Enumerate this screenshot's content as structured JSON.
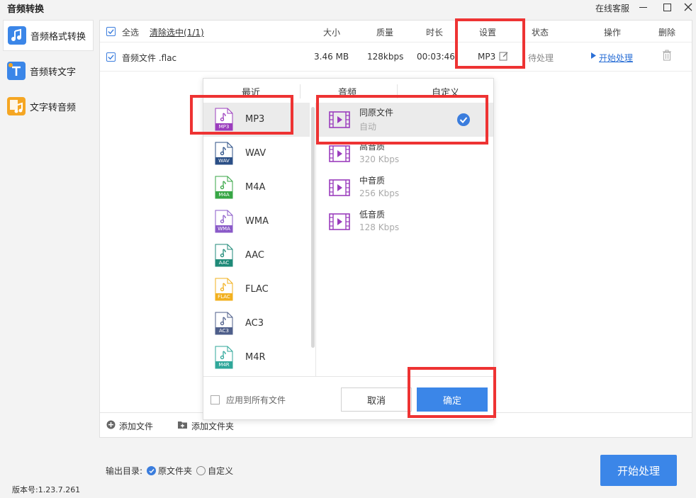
{
  "app": {
    "title": "音频转换",
    "service": "在线客服"
  },
  "sidebar": {
    "items": [
      {
        "label": "音频格式转换",
        "icon": "music-note-icon",
        "color": "#3b86e8",
        "active": true
      },
      {
        "label": "音频转文字",
        "icon": "text-t-icon",
        "color": "#3b86e8",
        "active": false
      },
      {
        "label": "文字转音频",
        "icon": "doc-to-audio-icon",
        "color": "#f5a623",
        "active": false
      }
    ],
    "version": "版本号:1.23.7.261"
  },
  "list": {
    "select_all": "全选",
    "clear_selected": "清除选中(1/1)",
    "headers": {
      "size": "大小",
      "quality": "质量",
      "duration": "时长",
      "settings": "设置",
      "status": "状态",
      "action": "操作",
      "delete": "删除"
    },
    "rows": [
      {
        "name": "音频文件 .flac",
        "size": "3.46 MB",
        "quality": "128kbps",
        "duration": "00:03:46",
        "format": "MP3",
        "status": "待处理",
        "action": "开始处理"
      }
    ],
    "add_file": "添加文件",
    "add_folder": "添加文件夹"
  },
  "output": {
    "label": "输出目录:",
    "original": "原文件夹",
    "custom": "自定义"
  },
  "start_button": "开始处理",
  "popup": {
    "tabs": [
      "最近",
      "音频",
      "自定义"
    ],
    "formats": [
      {
        "name": "MP3",
        "color": "#9b3dbd"
      },
      {
        "name": "WAV",
        "color": "#2b4f86"
      },
      {
        "name": "M4A",
        "color": "#37a645"
      },
      {
        "name": "WMA",
        "color": "#8a5ac8"
      },
      {
        "name": "AAC",
        "color": "#1f8a78"
      },
      {
        "name": "FLAC",
        "color": "#f2b01e"
      },
      {
        "name": "AC3",
        "color": "#4e5e8a"
      },
      {
        "name": "M4R",
        "color": "#2fa79a"
      }
    ],
    "qualities": [
      {
        "title": "同原文件",
        "sub": "自动"
      },
      {
        "title": "高音质",
        "sub": "320 Kbps"
      },
      {
        "title": "中音质",
        "sub": "256 Kbps"
      },
      {
        "title": "低音质",
        "sub": "128 Kbps"
      }
    ],
    "apply_all": "应用到所有文件",
    "cancel": "取消",
    "ok": "确定"
  },
  "colors": {
    "accent": "#3b86e8",
    "highlight": "#ee3333"
  }
}
